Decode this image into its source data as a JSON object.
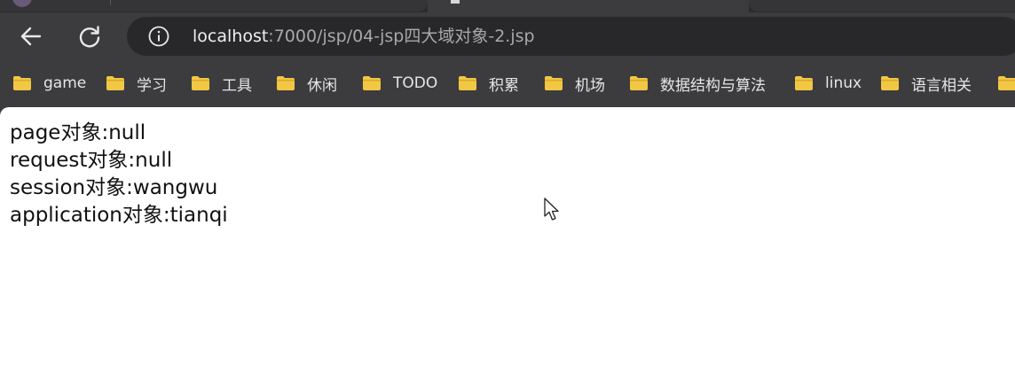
{
  "browser": {
    "address_bar": {
      "url_host": "localhost",
      "url_rest": ":7000/jsp/04-jsp四大域对象-2.jsp"
    },
    "nav": {
      "back_icon": "arrow-left-icon",
      "reload_icon": "reload-icon",
      "info_icon": "info-circle-icon"
    },
    "bookmarks": [
      {
        "label": "game",
        "icon": "folder-icon"
      },
      {
        "label": "学习",
        "icon": "folder-icon"
      },
      {
        "label": "工具",
        "icon": "folder-icon"
      },
      {
        "label": "休闲",
        "icon": "folder-icon"
      },
      {
        "label": "TODO",
        "icon": "folder-icon"
      },
      {
        "label": "积累",
        "icon": "folder-icon"
      },
      {
        "label": "机场",
        "icon": "folder-icon"
      },
      {
        "label": "数据结构与算法",
        "icon": "folder-icon"
      },
      {
        "label": "linux",
        "icon": "folder-icon"
      },
      {
        "label": "语言相关",
        "icon": "folder-icon"
      }
    ],
    "colors": {
      "chrome_bg": "#3c3c3f",
      "omnibox_bg": "#28282b",
      "folder_yellow": "#f2c744"
    }
  },
  "page": {
    "lines": [
      "page对象:null",
      "request对象:null",
      "session对象:wangwu",
      "application对象:tianqi"
    ]
  }
}
